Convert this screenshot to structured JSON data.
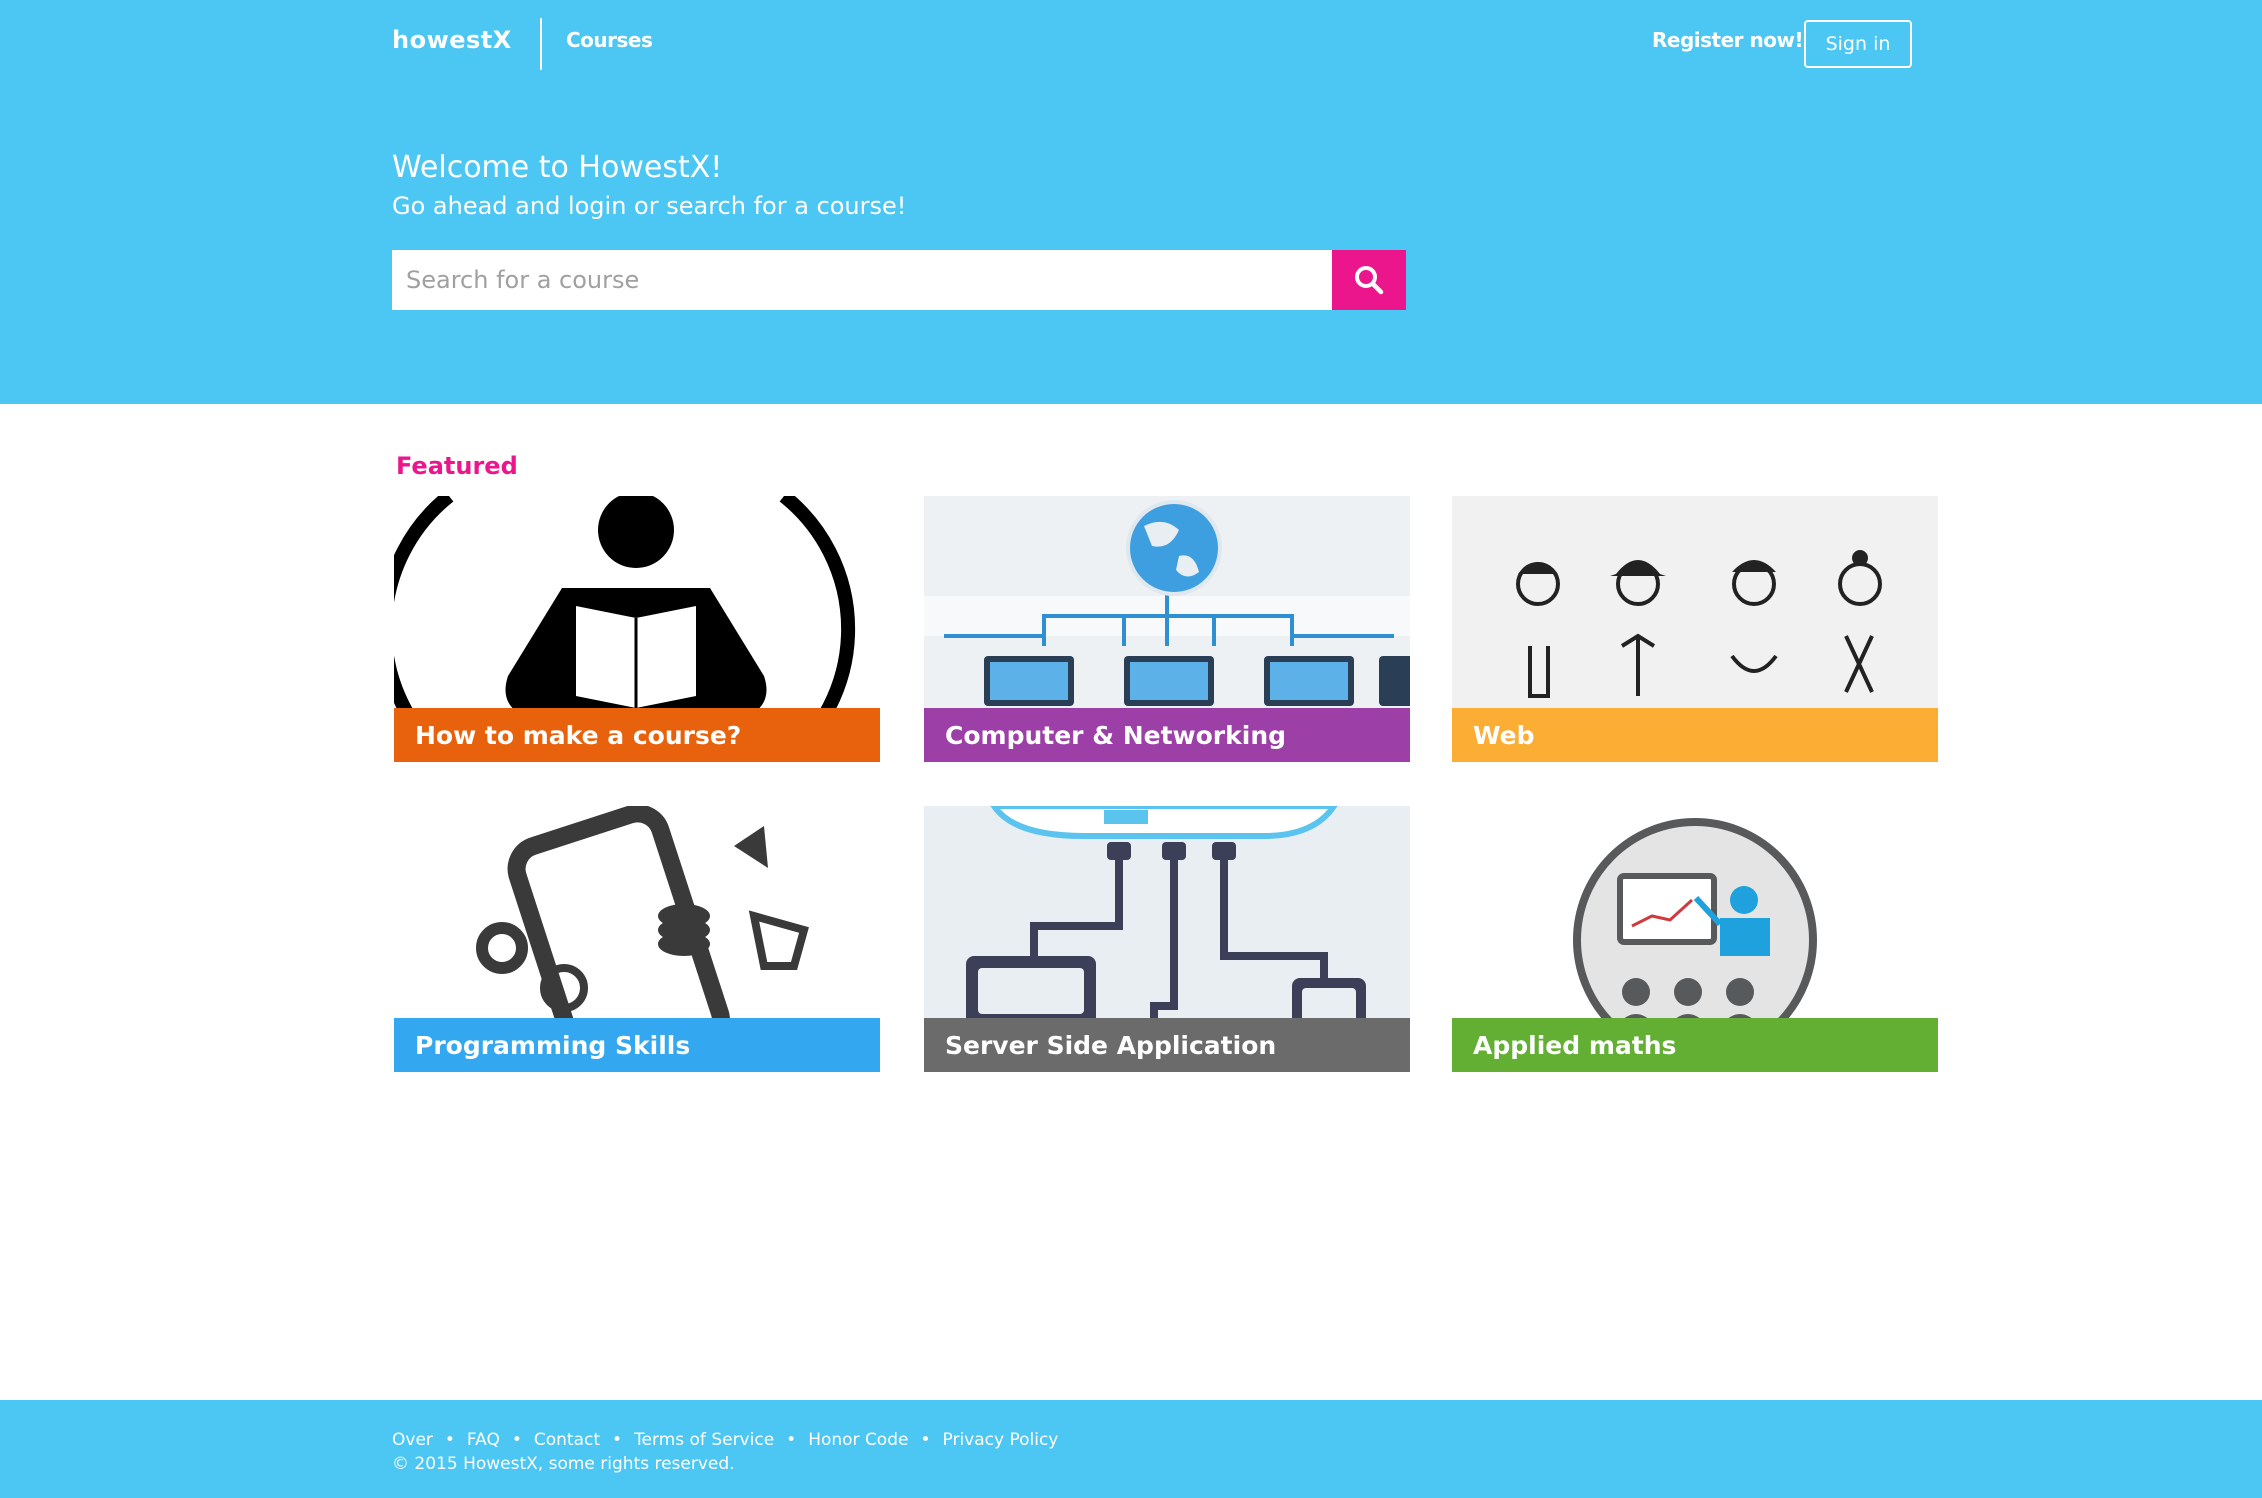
{
  "header": {
    "logo": "howestX",
    "nav_courses": "Courses",
    "register": "Register now!",
    "signin": "Sign in"
  },
  "hero": {
    "welcome": "Welcome to HowestX!",
    "subtitle": "Go ahead and login or search for a course!",
    "search_placeholder": "Search for a course",
    "search_value": ""
  },
  "featured": {
    "heading": "Featured",
    "courses": [
      {
        "title": "How to make a course?",
        "color": "#e8620e"
      },
      {
        "title": "Computer & Networking",
        "color": "#9c3fa6"
      },
      {
        "title": "Web",
        "color": "#fbae33"
      },
      {
        "title": "Programming Skills",
        "color": "#33a8f0"
      },
      {
        "title": "Server Side Application",
        "color": "#6b6b6b"
      },
      {
        "title": "Applied maths",
        "color": "#62af33"
      }
    ]
  },
  "footer": {
    "links": [
      "Over",
      "FAQ",
      "Contact",
      "Terms of Service",
      "Honor Code",
      "Privacy Policy"
    ],
    "copyright": "© 2015 HowestX, some rights reserved."
  },
  "colors": {
    "hero_bg": "#4cc6f2",
    "accent_pink": "#ec168c"
  }
}
